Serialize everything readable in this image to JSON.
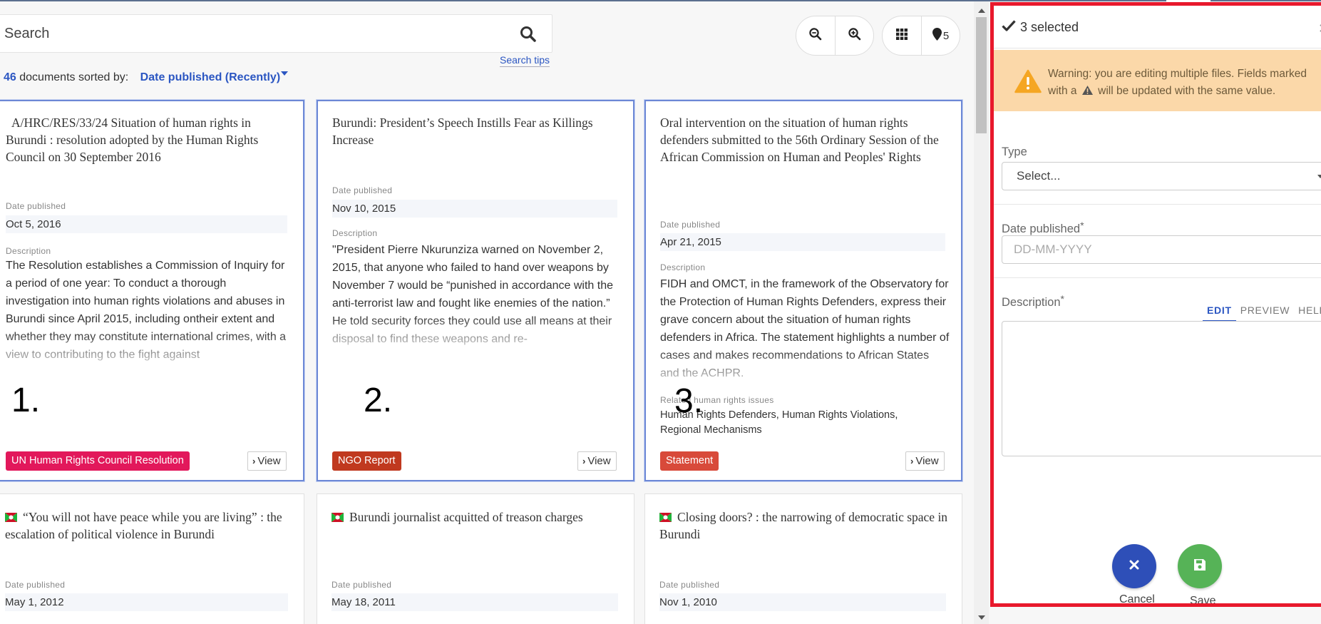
{
  "search": {
    "placeholder": "Search",
    "tips_label": "Search tips"
  },
  "toolbar": {
    "zoom_out_icon": "zoom-out-icon",
    "zoom_in_icon": "zoom-in-icon",
    "grid_icon": "grid-icon",
    "pin_count": "5"
  },
  "results": {
    "count": "46",
    "sorted_by_label": "documents sorted by:",
    "sort_value": "Date published (Recently)"
  },
  "cards": [
    {
      "title": "A/HRC/RES/33/24 Situation of human rights in Burundi : resolution adopted by the Human Rights Council on 30 September 2016",
      "date_label": "Date published",
      "date": "Oct 5, 2016",
      "desc_label": "Description",
      "description": "The Resolution establishes a Commission of Inquiry for a period of one year: To conduct a thorough investigation into human rights violations and abuses in Burundi since April 2015, including ontheir extent and whether they may constitute international crimes, with a view to contributing to the fight against",
      "number": "1.",
      "tag": "UN Human Rights Council Resolution",
      "tag_color": "#e2185b",
      "view_label": "View"
    },
    {
      "title": "Burundi: President’s Speech Instills Fear as Killings Increase",
      "date_label": "Date published",
      "date": "Nov 10, 2015",
      "desc_label": "Description",
      "description": "\"President Pierre Nkurunziza warned on November 2, 2015, that anyone who failed to hand over weapons by November 7 would be “punished in accordance with the anti-terrorist law and fought like enemies of the nation.” He told security forces they could use all means at their disposal to find these weapons and re-",
      "number": "2.",
      "tag": "NGO Report",
      "tag_color": "#c0391f",
      "view_label": "View"
    },
    {
      "title": "Oral intervention on the situation of human rights defenders submitted to the 56th Ordinary Session of the African Commission on Human and Peoples' Rights",
      "date_label": "Date published",
      "date": "Apr 21, 2015",
      "desc_label": "Description",
      "description": "FIDH and OMCT, in the framework of the Observatory for the Protection of Human Rights Defenders, express their grave concern about the situation of human rights defenders in Africa. The statement highlights a number of cases and makes recommendations to African States and the ACHPR.",
      "issues_label": "Related human rights issues",
      "issues": "Human Rights Defenders, Human Rights Violations, Regional Mechanisms",
      "number": "3.",
      "tag": "Statement",
      "tag_color": "#d84a3a",
      "view_label": "View"
    },
    {
      "title": "“You will not have peace while you are living” : the escalation of political violence in Burundi",
      "date_label": "Date published",
      "date": "May 1, 2012"
    },
    {
      "title": "Burundi journalist acquitted of treason charges",
      "date_label": "Date published",
      "date": "May 18, 2011"
    },
    {
      "title": "Closing doors? : the narrowing of democratic space in Burundi",
      "date_label": "Date published",
      "date": "Nov 1, 2010"
    }
  ],
  "panel": {
    "selected": "3 selected",
    "warning_part1": "Warning: you are editing multiple files. Fields marked",
    "warning_part2a": "with a",
    "warning_part2b": "will be updated with the same value.",
    "type_label": "Type",
    "type_value": "Select...",
    "date_label": "Date published",
    "date_placeholder": "DD-MM-YYYY",
    "desc_label": "Description",
    "required_mark": "*",
    "tabs": [
      "EDIT",
      "PREVIEW",
      "HELP"
    ],
    "cancel_label": "Cancel",
    "save_label": "Save"
  },
  "colors": {
    "accent": "#2b56c2",
    "selection_border": "#6c88d6",
    "panel_border": "#e8192c",
    "warning_bg": "#fbd8a9",
    "cancel": "#2e4fb8",
    "save": "#56b357"
  }
}
